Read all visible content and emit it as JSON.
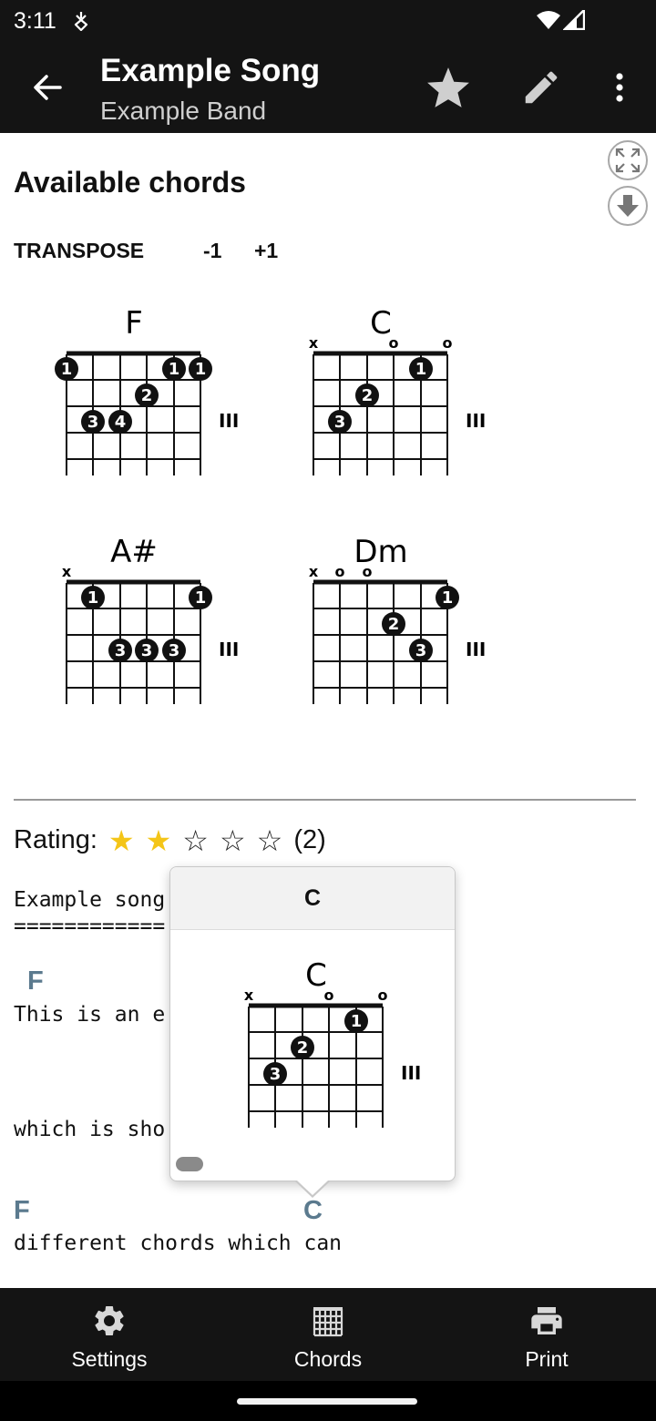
{
  "status_bar": {
    "time": "3:11"
  },
  "app_bar": {
    "title": "Example Song",
    "subtitle": "Example Band"
  },
  "content": {
    "section_title": "Available chords",
    "transpose": {
      "label": "TRANSPOSE",
      "down": "-1",
      "up": "+1"
    },
    "chords": [
      {
        "name": "F",
        "start_fret": "III",
        "markers": [
          "",
          "",
          "",
          "",
          "",
          ""
        ]
      },
      {
        "name": "C",
        "start_fret": "III",
        "markers": [
          "x",
          "",
          "",
          "o",
          "",
          "o"
        ]
      },
      {
        "name": "A#",
        "start_fret": "III",
        "markers": [
          "x",
          "",
          "",
          "",
          "",
          ""
        ]
      },
      {
        "name": "Dm",
        "start_fret": "III",
        "markers": [
          "x",
          "o",
          "o",
          "",
          "",
          ""
        ]
      }
    ],
    "rating": {
      "label": "Rating:",
      "stars_filled": 2,
      "stars_total": 5,
      "count": "(2)"
    },
    "song": {
      "title_line": "Example song",
      "underline": "============",
      "chord_line_1": "F",
      "lyric_line_1": "This is an e",
      "lyric_line_2": "which is sho",
      "chord_line_3a": "F",
      "chord_line_3b": "C",
      "lyric_line_3": "different chords which can"
    },
    "popup": {
      "title": "C",
      "chord_name": "C",
      "start_fret": "III"
    }
  },
  "bottom_nav": {
    "settings": "Settings",
    "chords": "Chords",
    "print": "Print"
  },
  "icons": {
    "back": "arrow-left-icon",
    "favorite": "star-icon",
    "edit": "pencil-icon",
    "more": "more-vert-icon",
    "fullscreen": "fullscreen-icon",
    "download": "download-icon",
    "settings": "gear-icon",
    "chords": "chord-grid-icon",
    "print": "printer-icon"
  }
}
